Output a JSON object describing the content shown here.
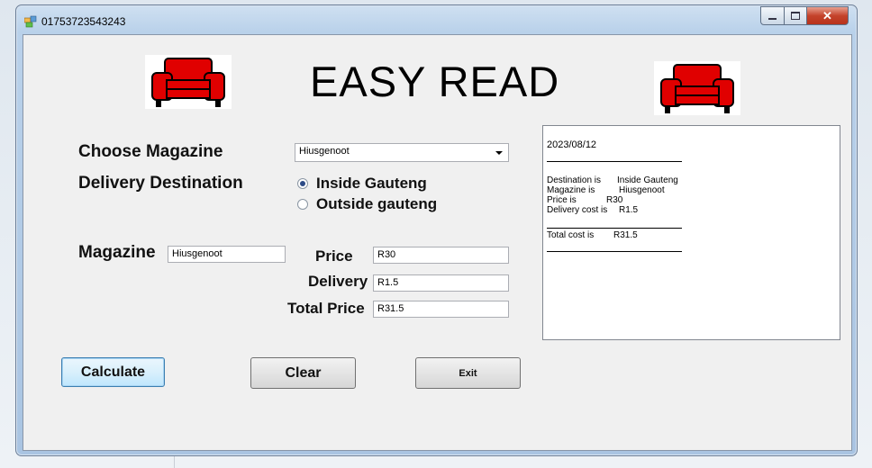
{
  "window": {
    "title": "01753723543243"
  },
  "header": {
    "title": "EASY READ"
  },
  "form": {
    "choose_magazine_label": "Choose Magazine",
    "magazine_selected": "Hiusgenoot",
    "delivery_destination_label": "Delivery Destination",
    "radio_inside_label": "Inside Gauteng",
    "radio_outside_label": "Outside gauteng",
    "radio_selected": "Inside Gauteng",
    "magazine_label": "Magazine",
    "magazine_value": "Hiusgenoot",
    "price_label": "Price",
    "price_value": "R30",
    "delivery_label": "Delivery",
    "delivery_value": "R1.5",
    "total_price_label": "Total Price",
    "total_price_value": "R31.5"
  },
  "receipt": {
    "date": "2023/08/12",
    "destination_label": "Destination is",
    "destination_value": "Inside Gauteng",
    "magazine_label": "Magazine is",
    "magazine_value": "Hiusgenoot",
    "price_label": "Price is",
    "price_value": "R30",
    "delivery_label": "Delivery cost is",
    "delivery_value": "R1.5",
    "total_label": "Total cost is",
    "total_value": "R31.5"
  },
  "buttons": {
    "calculate": "Calculate",
    "clear": "Clear",
    "exit": "Exit"
  },
  "icons": {
    "chair": "armchair-icon",
    "app": "app-icon",
    "dropdown": "chevron-down-icon"
  },
  "colors": {
    "chair": "#e00000",
    "accent": "#3c7fb1",
    "close": "#c4432b"
  }
}
